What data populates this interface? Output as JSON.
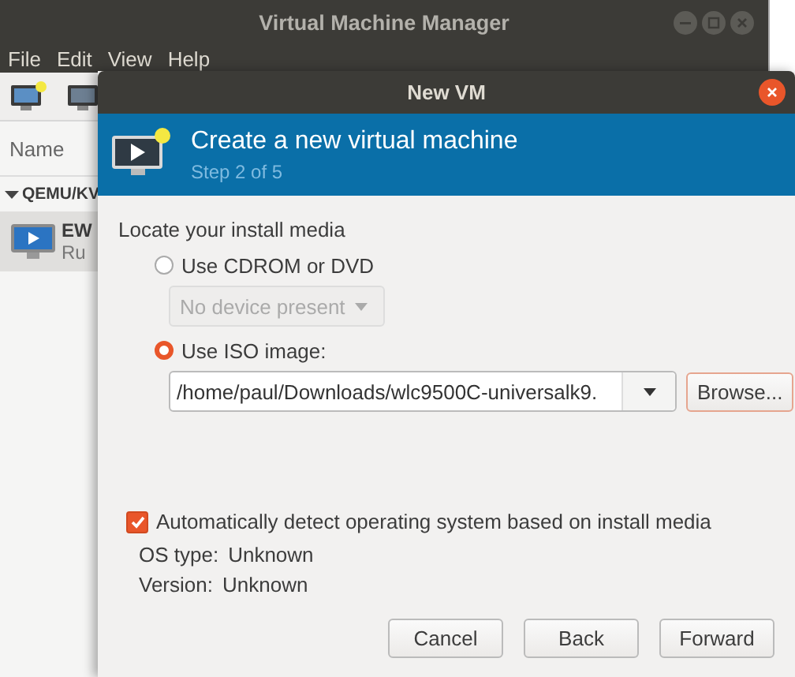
{
  "main_window": {
    "title": "Virtual Machine Manager",
    "menu": [
      "File",
      "Edit",
      "View",
      "Help"
    ],
    "list_header": "Name",
    "tree": [
      {
        "label": "QEMU/KV",
        "expanded": true,
        "children": [
          {
            "name": "EW",
            "status": "Ru",
            "selected": true
          }
        ]
      }
    ]
  },
  "dialog": {
    "title": "New VM",
    "heading": "Create a new virtual machine",
    "step": "Step 2 of 5",
    "section_label": "Locate your install media",
    "media_options": [
      {
        "label": "Use CDROM or DVD",
        "selected": false
      },
      {
        "label": "Use ISO image:",
        "selected": true
      }
    ],
    "cdrom_dropdown": {
      "value": "No device present",
      "disabled": true
    },
    "iso_path": {
      "value": "/home/paul/Downloads/wlc9500C-universalk9."
    },
    "browse_button": "Browse...",
    "auto_detect": {
      "label": "Automatically detect operating system based on install media",
      "checked": true
    },
    "os_info": [
      {
        "label": "OS type:",
        "value": "Unknown"
      },
      {
        "label": "Version:",
        "value": "Unknown"
      }
    ],
    "buttons": [
      "Cancel",
      "Back",
      "Forward"
    ]
  }
}
